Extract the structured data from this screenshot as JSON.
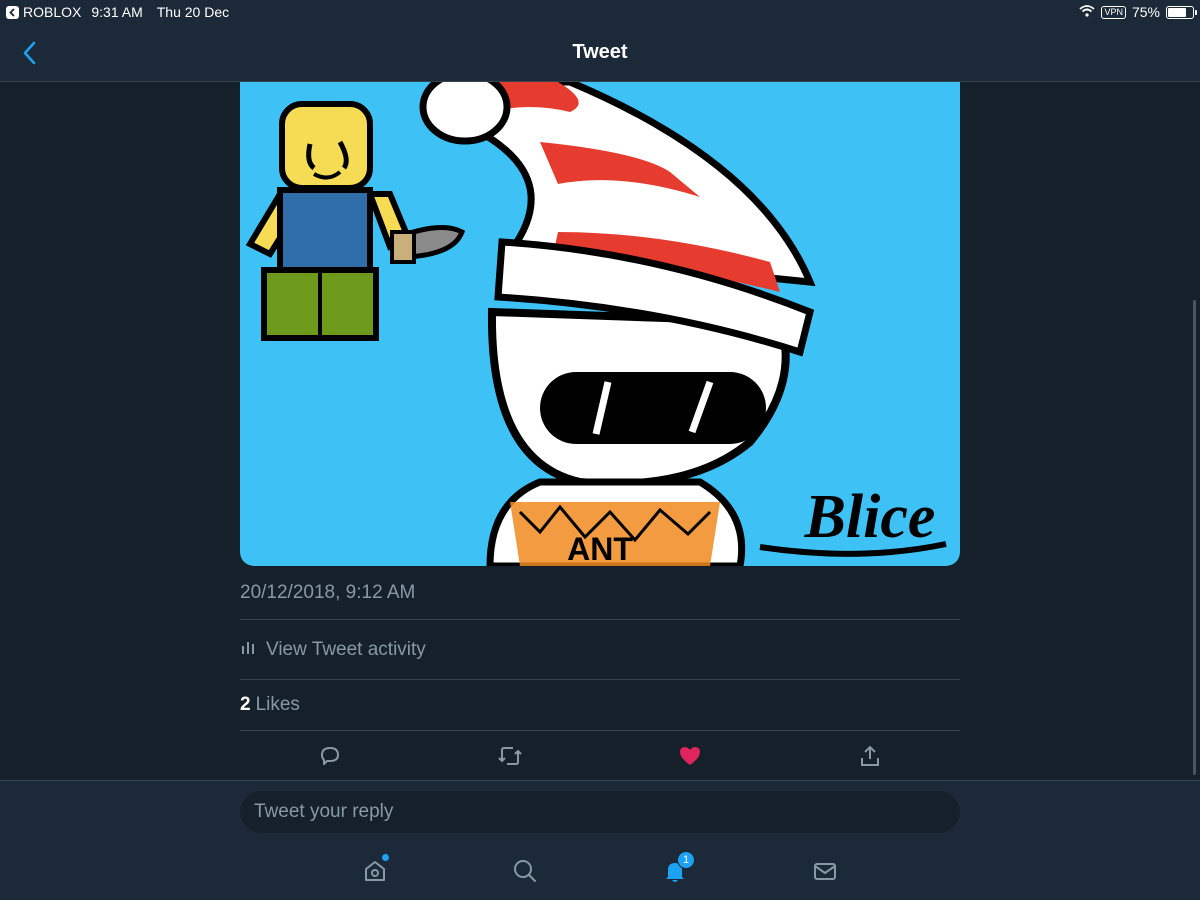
{
  "status_bar": {
    "app": "ROBLOX",
    "time": "9:31 AM",
    "date": "Thu 20 Dec",
    "vpn": "VPN",
    "battery": "75%",
    "battery_level": 0.75
  },
  "nav": {
    "title": "Tweet"
  },
  "tweet": {
    "image_signature": "Blice",
    "image_shirt_text": "ANT",
    "timestamp": "20/12/2018, 9:12 AM",
    "activity_label": "View Tweet activity",
    "likes_count": "2",
    "likes_label": "Likes",
    "liked": true
  },
  "reply": {
    "placeholder": "Tweet your reply"
  },
  "tabs": [
    {
      "name": "home-icon",
      "has_dot": true
    },
    {
      "name": "search-icon"
    },
    {
      "name": "notifications-icon",
      "badge": "1"
    },
    {
      "name": "messages-icon"
    }
  ],
  "colors": {
    "background": "#15202b",
    "bar": "#1c2938",
    "accent": "#1da1f2",
    "like": "#e0245e",
    "muted": "#8899a6",
    "image_sky": "#3ec2f5"
  }
}
